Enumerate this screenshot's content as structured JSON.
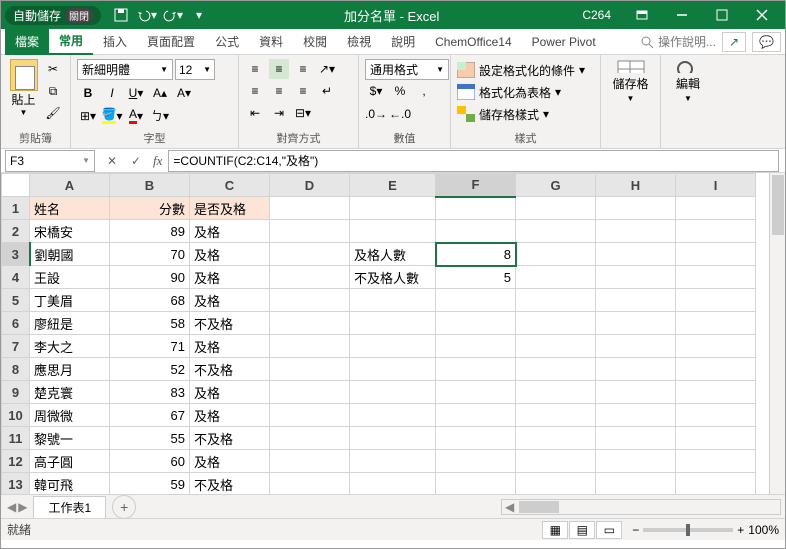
{
  "titlebar": {
    "autosave": "自動儲存",
    "autosave_state": "關閉",
    "title": "加分名單 - Excel",
    "account": "C264"
  },
  "menu": {
    "file": "檔案",
    "home": "常用",
    "insert": "插入",
    "layout": "頁面配置",
    "formulas": "公式",
    "data": "資料",
    "review": "校閱",
    "view": "檢視",
    "help": "說明",
    "chem": "ChemOffice14",
    "pivot": "Power Pivot",
    "search": "操作說明..."
  },
  "ribbon": {
    "clipboard": {
      "paste": "貼上",
      "label": "剪貼簿"
    },
    "font": {
      "name": "新細明體",
      "size": "12",
      "label": "字型"
    },
    "align": {
      "label": "對齊方式"
    },
    "number": {
      "format": "通用格式",
      "label": "數值"
    },
    "styles": {
      "cond": "設定格式化的條件",
      "table": "格式化為表格",
      "cell": "儲存格樣式",
      "label": "樣式"
    },
    "cells": {
      "label": "儲存格"
    },
    "editing": {
      "label": "編輯"
    }
  },
  "namebox": "F3",
  "formula": "=COUNTIF(C2:C14,\"及格\")",
  "columns": [
    "A",
    "B",
    "C",
    "D",
    "E",
    "F",
    "G",
    "H",
    "I"
  ],
  "cells": {
    "A1": "姓名",
    "B1": "分數",
    "C1": "是否及格",
    "A2": "宋橋安",
    "B2": "89",
    "C2": "及格",
    "A3": "劉朝國",
    "B3": "70",
    "C3": "及格",
    "E3": "及格人數",
    "F3": "8",
    "A4": "王設",
    "B4": "90",
    "C4": "及格",
    "E4": "不及格人數",
    "F4": "5",
    "A5": "丁美眉",
    "B5": "68",
    "C5": "及格",
    "A6": "廖紐是",
    "B6": "58",
    "C6": "不及格",
    "A7": "李大之",
    "B7": "71",
    "C7": "及格",
    "A8": "應思月",
    "B8": "52",
    "C8": "不及格",
    "A9": "楚克寰",
    "B9": "83",
    "C9": "及格",
    "A10": "周微微",
    "B10": "67",
    "C10": "及格",
    "A11": "黎號一",
    "B11": "55",
    "C11": "不及格",
    "A12": "高子圓",
    "B12": "60",
    "C12": "及格",
    "A13": "韓可飛",
    "B13": "59",
    "C13": "不及格"
  },
  "sheet": {
    "name": "工作表1"
  },
  "status": {
    "ready": "就緒",
    "zoom": "100%"
  }
}
